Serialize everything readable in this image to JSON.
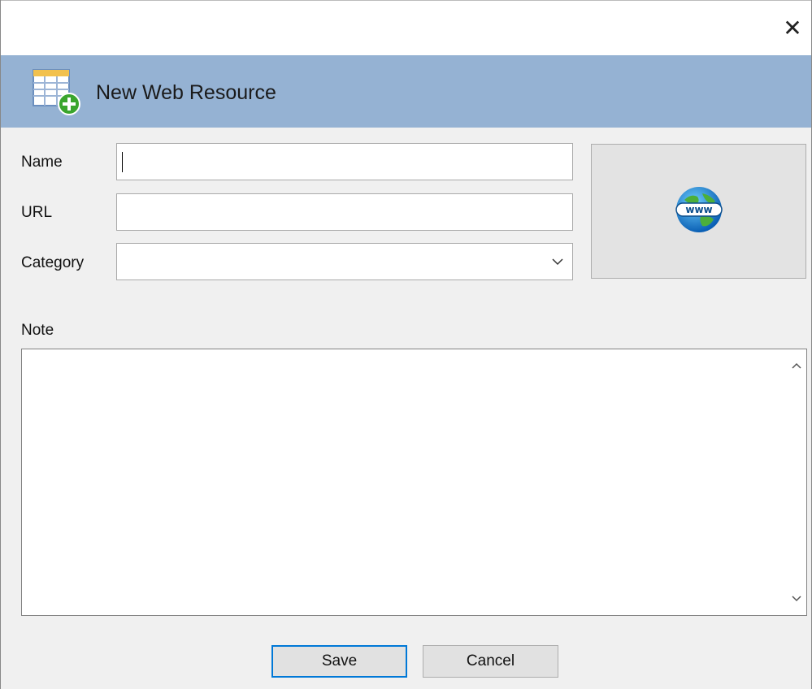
{
  "window": {
    "close_glyph": "✕"
  },
  "header": {
    "title": "New Web Resource",
    "icon": "table-add-icon"
  },
  "form": {
    "name_label": "Name",
    "name_value": "",
    "url_label": "URL",
    "url_value": "",
    "category_label": "Category",
    "category_value": "",
    "note_label": "Note",
    "note_value": ""
  },
  "image_panel": {
    "icon": "globe-www-icon"
  },
  "buttons": {
    "save_label": "Save",
    "cancel_label": "Cancel"
  },
  "colors": {
    "header_bg": "#95b2d3",
    "window_bg": "#f0f0f0",
    "default_button_border": "#0078d7"
  }
}
